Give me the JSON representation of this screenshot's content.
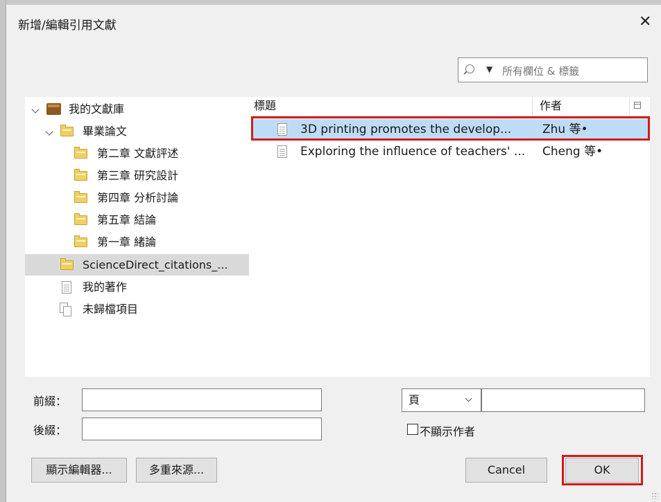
{
  "dialog": {
    "title": "新增/編輯引用文獻"
  },
  "search": {
    "placeholder": "所有欄位 & 標籤"
  },
  "library_tree": [
    {
      "label": "我的文獻庫",
      "icon": "library-icon",
      "expanded": true
    },
    {
      "label": "畢業論文",
      "icon": "folder-icon",
      "expanded": true
    },
    {
      "label": "第二章 文獻評述",
      "icon": "folder-icon"
    },
    {
      "label": "第三章 研究設計",
      "icon": "folder-icon"
    },
    {
      "label": "第四章 分析討論",
      "icon": "folder-icon"
    },
    {
      "label": "第五章 結論",
      "icon": "folder-icon"
    },
    {
      "label": "第一章 緒論",
      "icon": "folder-icon"
    },
    {
      "label": "ScienceDirect_citations_...",
      "icon": "folder-icon",
      "selected": true
    },
    {
      "label": "我的著作",
      "icon": "document-icon"
    },
    {
      "label": "未歸檔項目",
      "icon": "unfiled-items-icon"
    }
  ],
  "items_table": {
    "columns": {
      "title": "標題",
      "creator": "作者"
    },
    "rows": [
      {
        "title": "3D printing promotes the develop...",
        "creator": "Zhu 等•",
        "selected": true
      },
      {
        "title": "Exploring the influence of teachers' ...",
        "creator": "Cheng 等•",
        "selected": false
      }
    ]
  },
  "citation_options": {
    "prefix_label": "前綴：",
    "prefix_value": "",
    "suffix_label": "後綴：",
    "suffix_value": "",
    "locator_type": "頁",
    "locator_value": "",
    "suppress_author_label": "不顯示作者",
    "suppress_author_checked": false
  },
  "buttons": {
    "show_editor": "顯示編輯器...",
    "multiple_sources": "多重來源...",
    "cancel": "Cancel",
    "ok": "OK"
  },
  "highlight_color": "#d11b1b",
  "selection_color": "#bfdcf7"
}
